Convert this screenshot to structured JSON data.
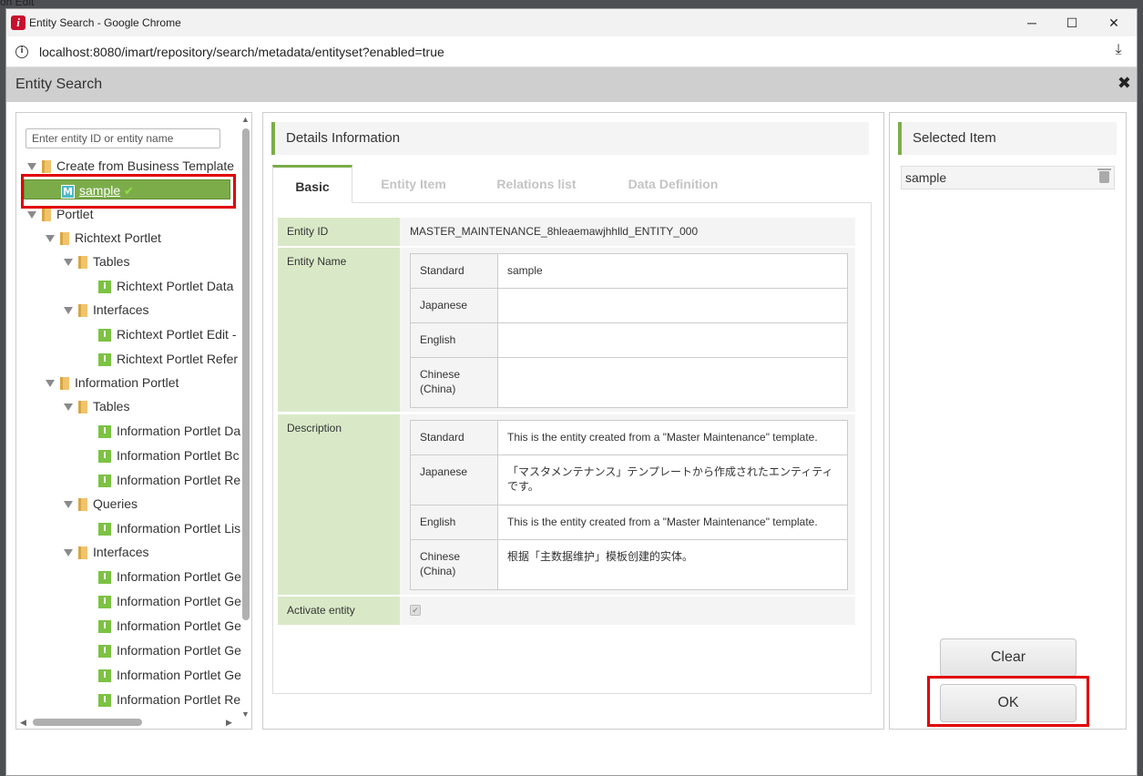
{
  "background": {
    "edge_text": "on Edit"
  },
  "window": {
    "title": "Entity Search - Google Chrome",
    "minimize": "─",
    "maximize": "☐",
    "close": "✕"
  },
  "address": {
    "url": "localhost:8080/imart/repository/search/metadata/entityset?enabled=true"
  },
  "dialog": {
    "title": "Entity Search",
    "close": "✖"
  },
  "tree": {
    "search_placeholder": "Enter entity ID or entity name",
    "nodes": [
      {
        "label": "Create from Business Template"
      },
      {
        "label": "sample",
        "badge": "M",
        "check": "✔"
      },
      {
        "label": "Portlet"
      },
      {
        "label": "Richtext Portlet"
      },
      {
        "label": "Tables"
      },
      {
        "label": "Richtext Portlet Data"
      },
      {
        "label": "Interfaces"
      },
      {
        "label": "Richtext Portlet Edit -"
      },
      {
        "label": "Richtext Portlet Refer"
      },
      {
        "label": "Information Portlet"
      },
      {
        "label": "Tables"
      },
      {
        "label": "Information Portlet Da"
      },
      {
        "label": "Information Portlet Bc"
      },
      {
        "label": "Information Portlet Re"
      },
      {
        "label": "Queries"
      },
      {
        "label": "Information Portlet Lis"
      },
      {
        "label": "Interfaces"
      },
      {
        "label": "Information Portlet Ge"
      },
      {
        "label": "Information Portlet Ge"
      },
      {
        "label": "Information Portlet Ge"
      },
      {
        "label": "Information Portlet Ge"
      },
      {
        "label": "Information Portlet Ge"
      },
      {
        "label": "Information Portlet Re"
      }
    ],
    "item_badge": "I"
  },
  "details": {
    "header": "Details Information",
    "tabs": [
      "Basic",
      "Entity Item",
      "Relations list",
      "Data Definition"
    ],
    "entity_id_label": "Entity ID",
    "entity_id_value": "MASTER_MAINTENANCE_8hleaemawjhhlld_ENTITY_000",
    "entity_name_label": "Entity Name",
    "entity_name": [
      {
        "lang": "Standard",
        "value": "sample"
      },
      {
        "lang": "Japanese",
        "value": ""
      },
      {
        "lang": "English",
        "value": ""
      },
      {
        "lang": "Chinese (China)",
        "value": ""
      }
    ],
    "description_label": "Description",
    "description": [
      {
        "lang": "Standard",
        "value": "This is the entity created from a \"Master Maintenance\" template."
      },
      {
        "lang": "Japanese",
        "value": "「マスタメンテナンス」テンプレートから作成されたエンティティです。"
      },
      {
        "lang": "English",
        "value": "This is the entity created from a \"Master Maintenance\" template."
      },
      {
        "lang": "Chinese (China)",
        "value": "根据「主数据维护」模板创建的实体。"
      }
    ],
    "activate_label": "Activate entity",
    "activate_checked": true,
    "check_glyph": "✔"
  },
  "selected": {
    "header": "Selected Item",
    "items": [
      "sample"
    ],
    "clear_label": "Clear",
    "ok_label": "OK"
  },
  "colors": {
    "accent_green": "#7cac4a",
    "label_bg": "#d9e9c7",
    "highlight_red": "#e00000"
  }
}
